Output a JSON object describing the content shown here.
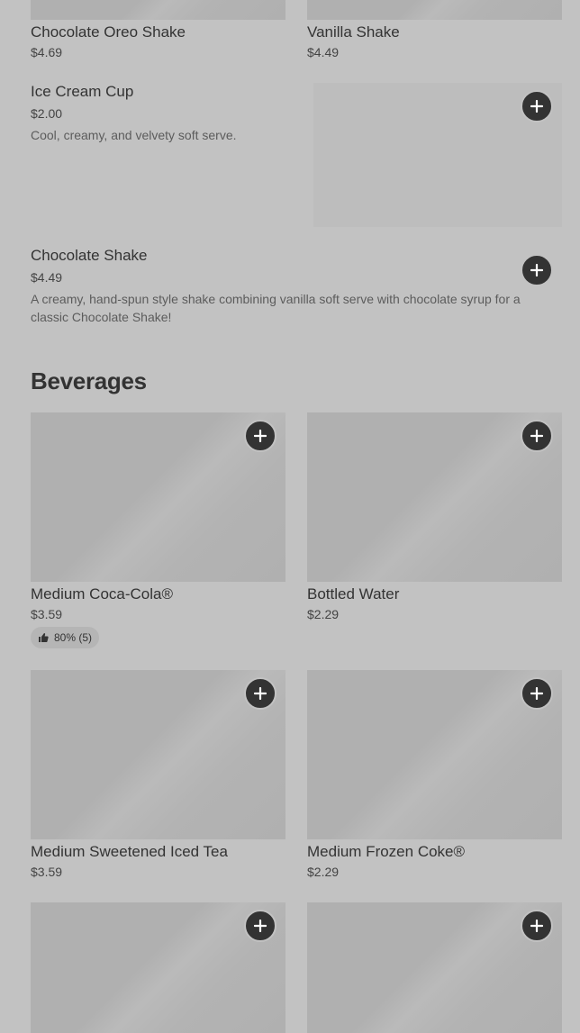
{
  "top_row": [
    {
      "name": "Chocolate Oreo Shake",
      "price": "$4.69"
    },
    {
      "name": "Vanilla Shake",
      "price": "$4.49"
    }
  ],
  "list_items": [
    {
      "name": "Ice Cream Cup",
      "price": "$2.00",
      "description": "Cool, creamy, and velvety soft serve."
    },
    {
      "name": "Chocolate Shake",
      "price": "$4.49",
      "description": "A creamy, hand-spun style shake combining vanilla soft serve with chocolate syrup for a classic Chocolate Shake!"
    }
  ],
  "beverages": {
    "title": "Beverages",
    "items": [
      {
        "name": "Medium Coca-Cola®",
        "price": "$3.59",
        "rating": "80% (5)"
      },
      {
        "name": "Bottled Water",
        "price": "$2.29"
      },
      {
        "name": "Medium Sweetened Iced Tea",
        "price": "$3.59"
      },
      {
        "name": "Medium Frozen Coke®",
        "price": "$2.29"
      }
    ]
  },
  "icons": {
    "add": "plus-icon",
    "rating": "thumbs-up-icon"
  }
}
